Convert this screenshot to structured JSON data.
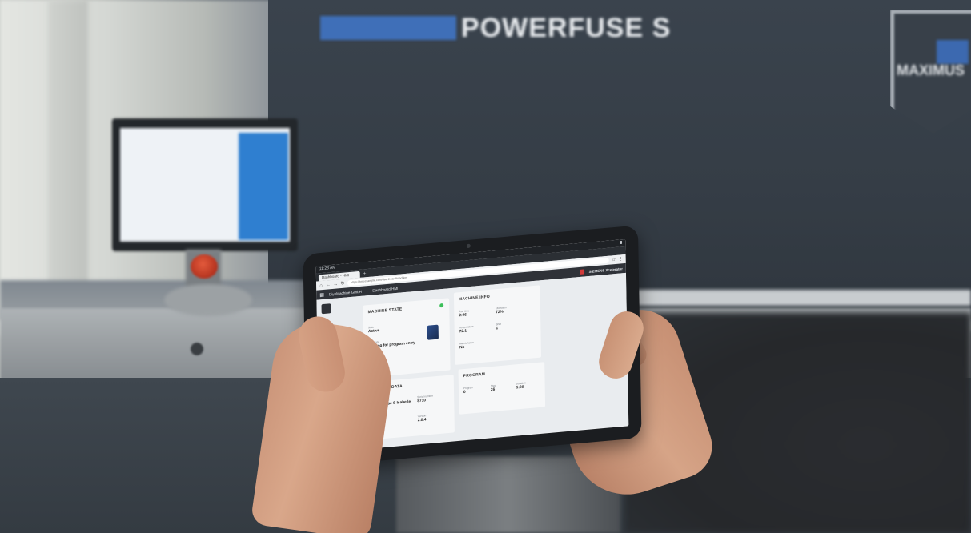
{
  "scene": {
    "background_brand_text": "POWERFUSE S",
    "background_badge_text": "MAXIMUS"
  },
  "tablet": {
    "status_time": "11:23 AM",
    "tab_title": "Dashboard - HMI",
    "url": "https://hmi.example.com/dashboard/machine",
    "appbar": {
      "crumb_1": "DiyoMachine GmbH",
      "crumb_2": "Dashboard HMI",
      "brand": "SIEMENS Xcelerator"
    },
    "machine_state": {
      "title": "MACHINE STATE",
      "state_label": "State",
      "state_value": "Active",
      "sub_state_label": "Sub state",
      "sub_state_value": "Waiting for program entry",
      "alarm_label": "Alarm",
      "alarm_value": "No"
    },
    "machine_info": {
      "title": "MACHINE INFO",
      "field_1_label": "Run time",
      "field_1_value": "2:06",
      "field_2_label": "Utilization",
      "field_2_value": "72%",
      "field_3_label": "Temperature",
      "field_3_value": "72.1",
      "field_4_label": "Shift",
      "field_4_value": "1",
      "field_5_label": "Maintenance",
      "field_5_value": "No"
    },
    "master_data": {
      "title": "MASTER DATA",
      "field_1_label": "Machine name",
      "field_1_value": "Powerfuse S Isabelle",
      "field_2_label": "Serial number",
      "field_2_value": "8710",
      "field_3_label": "Software",
      "field_3_value": "9.03",
      "field_4_label": "Version",
      "field_4_value": "2.0.4"
    },
    "program": {
      "title": "PROGRAM",
      "field_1_label": "Program",
      "field_1_value": "0",
      "field_2_label": "Step",
      "field_2_value": "26",
      "field_3_label": "Duration",
      "field_3_value": "1:20"
    }
  },
  "colors": {
    "status_ok": "#3cbf5a",
    "appbar_bg": "#2f3238",
    "brand_blue": "#3f6fb8"
  }
}
